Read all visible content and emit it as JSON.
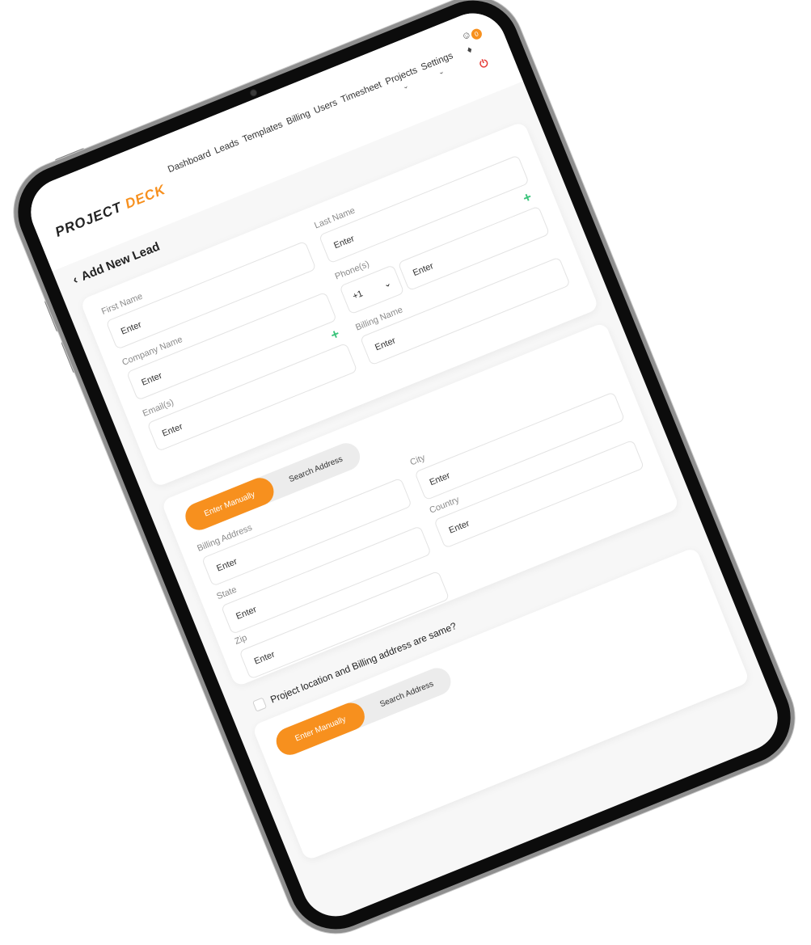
{
  "header": {
    "logo_part1": "PROJECT",
    "logo_part2": "DECK",
    "nav": [
      {
        "label": "Dashboard"
      },
      {
        "label": "Leads"
      },
      {
        "label": "Templates"
      },
      {
        "label": "Billing"
      },
      {
        "label": "Users"
      },
      {
        "label": "Timesheet"
      },
      {
        "label": "Projects"
      },
      {
        "label": "Settings"
      }
    ],
    "notification_count": "0",
    "icons": {
      "user": "user-circle-icon",
      "bell": "bell-icon",
      "power": "power-icon"
    }
  },
  "page": {
    "title": "Add New Lead",
    "back_glyph": "‹"
  },
  "lead_form": {
    "first_name": {
      "label": "First Name",
      "placeholder": "Enter"
    },
    "last_name": {
      "label": "Last Name",
      "placeholder": "Enter"
    },
    "company_name": {
      "label": "Company Name",
      "placeholder": "Enter"
    },
    "phones": {
      "label": "Phone(s)",
      "country_code": "+1",
      "placeholder": "Enter"
    },
    "emails": {
      "label": "Email(s)",
      "placeholder": "Enter"
    },
    "billing_name": {
      "label": "Billing Name",
      "placeholder": "Enter"
    }
  },
  "billing_address": {
    "toggle": {
      "manual": "Enter Manually",
      "search": "Search Address"
    },
    "billing_address": {
      "label": "Billing Address",
      "placeholder": "Enter"
    },
    "city": {
      "label": "City",
      "placeholder": "Enter"
    },
    "state": {
      "label": "State",
      "placeholder": "Enter"
    },
    "country": {
      "label": "Country",
      "placeholder": "Enter"
    },
    "zip": {
      "label": "Zip",
      "placeholder": "Enter"
    }
  },
  "project_location": {
    "same_as_billing": "Project location and Billing address are same?",
    "toggle": {
      "manual": "Enter Manually",
      "search": "Search Address"
    }
  },
  "colors": {
    "accent": "#f7901e",
    "add": "#3cc47c",
    "power": "#e53935"
  }
}
